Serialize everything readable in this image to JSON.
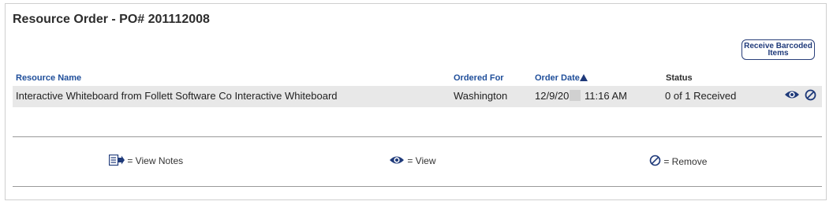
{
  "page": {
    "title": "Resource Order - PO# 201112008",
    "receive_button_line1": "Receive Barcoded",
    "receive_button_line2": "Items"
  },
  "table": {
    "headers": {
      "resource_name": "Resource Name",
      "ordered_for": "Ordered For",
      "order_date": "Order Date",
      "status": "Status"
    },
    "rows": [
      {
        "resource_name": "Interactive Whiteboard from Follett Software Co Interactive Whiteboard",
        "ordered_for": "Washington",
        "order_date_prefix": "12/9/20",
        "order_time": "11:16 AM",
        "status": "0 of 1 Received"
      }
    ]
  },
  "legend": {
    "view_notes": "= View Notes",
    "view": "= View",
    "remove": "= Remove"
  },
  "icons": {
    "view_notes": "notes-arrow-icon",
    "view": "eye-icon",
    "remove": "remove-circle-icon",
    "sort": "sort-ascending-icon"
  },
  "colors": {
    "accent": "#1f3a7a",
    "header_link": "#1f4e9a",
    "row_background": "#e8e8e8"
  }
}
